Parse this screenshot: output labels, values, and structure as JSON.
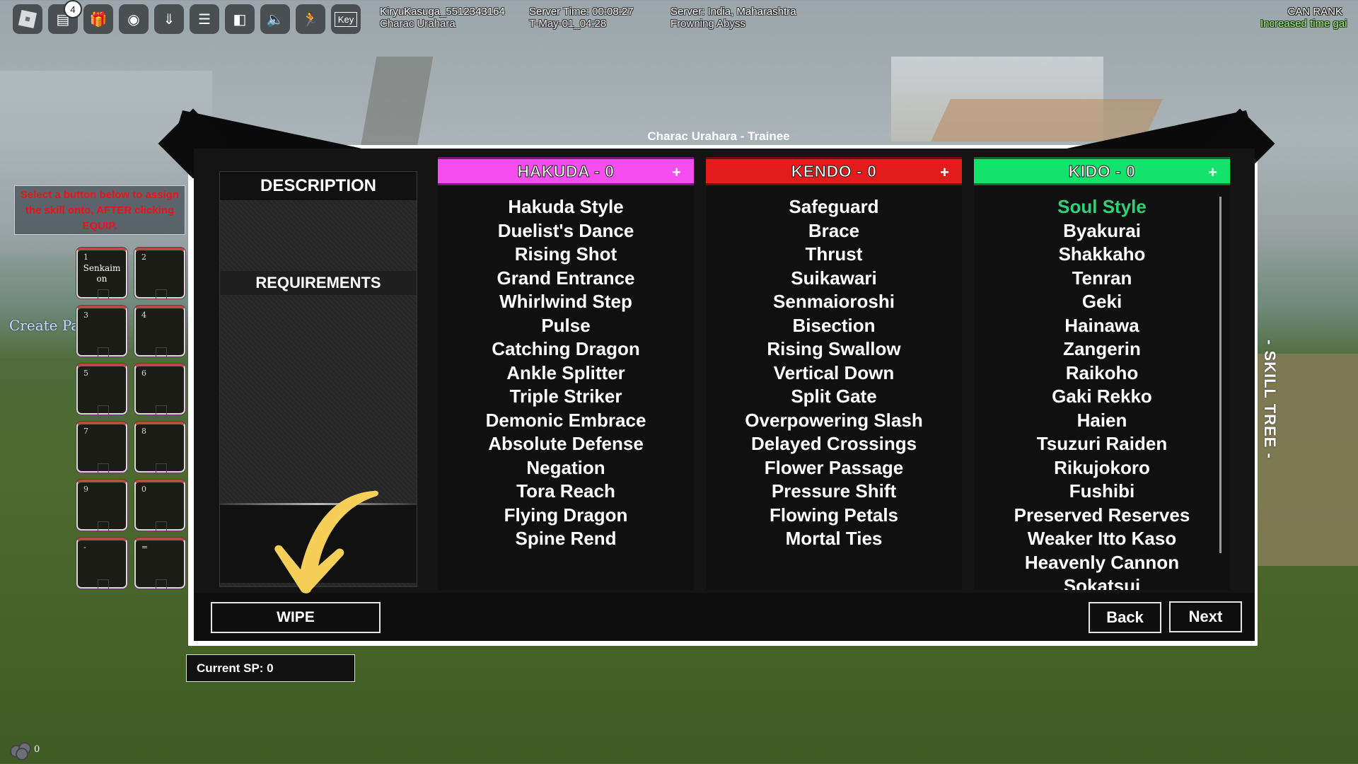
{
  "topbar": {
    "icons": [
      {
        "name": "roblox-menu-icon"
      },
      {
        "name": "chat-icon",
        "badge": "4"
      },
      {
        "name": "gift-icon"
      },
      {
        "name": "camera-icon"
      },
      {
        "name": "download-icon"
      },
      {
        "name": "server-icon"
      },
      {
        "name": "door-exit-icon"
      },
      {
        "name": "speaker-icon"
      },
      {
        "name": "sprint-icon"
      },
      {
        "name": "key-icon",
        "label": "Key"
      }
    ],
    "player": {
      "username": "KiryuKasuga_5512343164",
      "character": "Charac Urahara"
    },
    "server_time": {
      "time": "Server Time: 00:08:27",
      "date": "T-May-01_04:28"
    },
    "server": {
      "location": "Server: India, Maharashtra",
      "name": "Frowning Abyss"
    },
    "rank": {
      "title": "CAN RANK",
      "note": "Increased time gai"
    }
  },
  "hotbar": {
    "hint": "Select a button below to assign the skill onto, AFTER clicking EQUIP.",
    "create_party": "Create Party",
    "slots": [
      {
        "key": "1",
        "skill": "Senkaimon"
      },
      {
        "key": "2",
        "skill": ""
      },
      {
        "key": "3",
        "skill": ""
      },
      {
        "key": "4",
        "skill": ""
      },
      {
        "key": "5",
        "skill": ""
      },
      {
        "key": "6",
        "skill": ""
      },
      {
        "key": "7",
        "skill": ""
      },
      {
        "key": "8",
        "skill": ""
      },
      {
        "key": "9",
        "skill": ""
      },
      {
        "key": "0",
        "skill": ""
      },
      {
        "key": "-",
        "skill": ""
      },
      {
        "key": "=",
        "skill": ""
      }
    ]
  },
  "panel": {
    "title": "Charac Urahara - Trainee",
    "side_label": "- SKILL TREE -",
    "description_heading": "DESCRIPTION",
    "requirements_heading": "REQUIREMENTS",
    "wipe_label": "WIPE",
    "back_label": "Back",
    "next_label": "Next",
    "current_sp": "Current SP: 0",
    "columns": [
      {
        "title": "HAKUDA - 0",
        "color": "#f54df0",
        "border": "#7a1a77",
        "plus": "+",
        "skills": [
          "Hakuda Style",
          "Duelist's Dance",
          "Rising Shot",
          "Grand Entrance",
          "Whirlwind Step",
          "Pulse",
          "Catching Dragon",
          "Ankle Splitter",
          "Triple Striker",
          "Demonic Embrace",
          "Absolute Defense",
          "Negation",
          "Tora Reach",
          "Flying Dragon",
          "Spine Rend"
        ]
      },
      {
        "title": "KENDO - 0",
        "color": "#e31b1b",
        "border": "#6e0d0d",
        "plus": "+",
        "skills": [
          "Safeguard",
          "Brace",
          "Thrust",
          "Suikawari",
          "Senmaioroshi",
          "Bisection",
          "Rising Swallow",
          "Vertical Down",
          "Split Gate",
          "Overpowering Slash",
          "Delayed Crossings",
          "Flower Passage",
          "Pressure Shift",
          "Flowing Petals",
          "Mortal Ties"
        ]
      },
      {
        "title": "KIDO - 0",
        "color": "#13e36a",
        "border": "#0a6a30",
        "plus": "+",
        "active_skill": "Soul Style",
        "active_color": "#2fd277",
        "skills": [
          "Soul Style",
          "Byakurai",
          "Shakkaho",
          "Tenran",
          "Geki",
          "Hainawa",
          "Zangerin",
          "Raikoho",
          "Gaki Rekko",
          "Haien",
          "Tsuzuri Raiden",
          "Rikujokoro",
          "Fushibi",
          "Preserved Reserves",
          "Weaker Itto Kaso",
          "Heavenly Cannon",
          "Sokatsui"
        ]
      }
    ]
  },
  "footer": {
    "gears_count": "0"
  }
}
